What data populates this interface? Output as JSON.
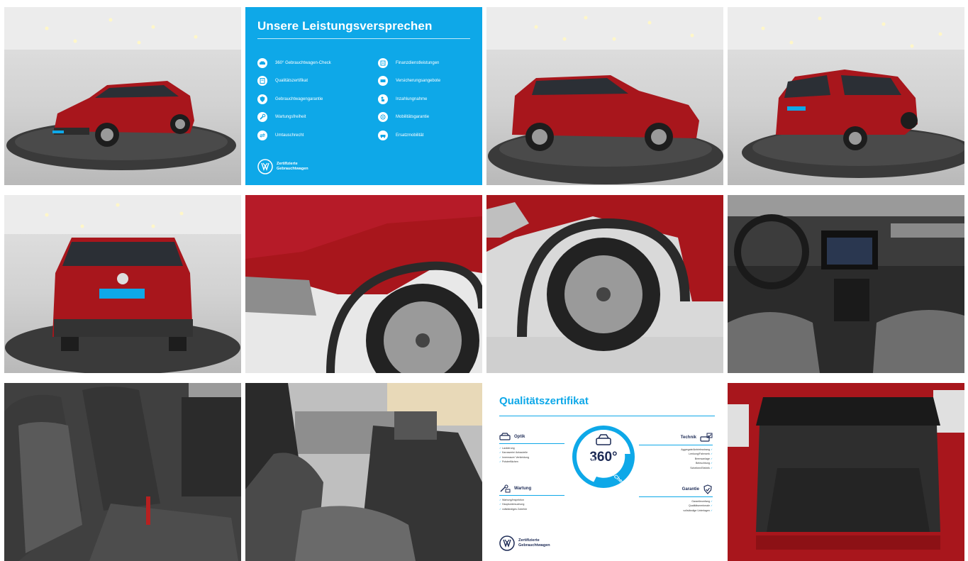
{
  "colors": {
    "vw_blue": "#0ea8e8",
    "vw_navy": "#1c2a55",
    "car_red": "#a8161c"
  },
  "promise": {
    "title": "Unsere Leistungsversprechen",
    "left_items": [
      {
        "label": "360° Gebrauchtwagen-Check",
        "icon": "car-check-icon"
      },
      {
        "label": "Qualitätszertifikat",
        "icon": "certificate-icon"
      },
      {
        "label": "Gebrauchtwagengarantie",
        "icon": "shield-icon"
      },
      {
        "label": "Wartungsfreiheit",
        "icon": "wrench-icon"
      },
      {
        "label": "Umtauschrecht",
        "icon": "exchange-icon"
      }
    ],
    "right_items": [
      {
        "label": "Finanzdienstleistungen",
        "icon": "finance-icon"
      },
      {
        "label": "Versicherungsangebote",
        "icon": "insurance-icon"
      },
      {
        "label": "Inzahlungnahme",
        "icon": "trade-in-icon"
      },
      {
        "label": "Mobilitätsgarantie",
        "icon": "mobility-icon"
      },
      {
        "label": "Ersatzmobilität",
        "icon": "replacement-car-icon"
      }
    ],
    "brand_label": "Zertifizierte Gebrauchtwagen"
  },
  "cert": {
    "title": "Qualitätszertifikat",
    "seal_number": "360°",
    "seal_text": "Gebrauchtwagen-Check",
    "groups": {
      "optik": {
        "title": "Optik",
        "items": [
          "Lackierung",
          "Karosserie/ Anbauteile",
          "Innenraum/ Verkleidung",
          "Polsterflächen"
        ]
      },
      "wartung": {
        "title": "Wartung",
        "items": [
          "Wartung/Inspektion",
          "Hauptuntersuchung",
          "vollständiges Zubehör"
        ]
      },
      "technik": {
        "title": "Technik",
        "items": [
          "Aggregate/Antriebsstrang",
          "Lenkung/Fahrwerk",
          "Bremsanlage",
          "Beleuchtung",
          "Scheiben/Elektrik"
        ]
      },
      "garantie": {
        "title": "Garantie",
        "items": [
          "Garantieumfang",
          "Qualitätsmerkmale",
          "vollständige Unterlagen"
        ]
      }
    },
    "brand_label": "Zertifizierte Gebrauchtwagen"
  }
}
